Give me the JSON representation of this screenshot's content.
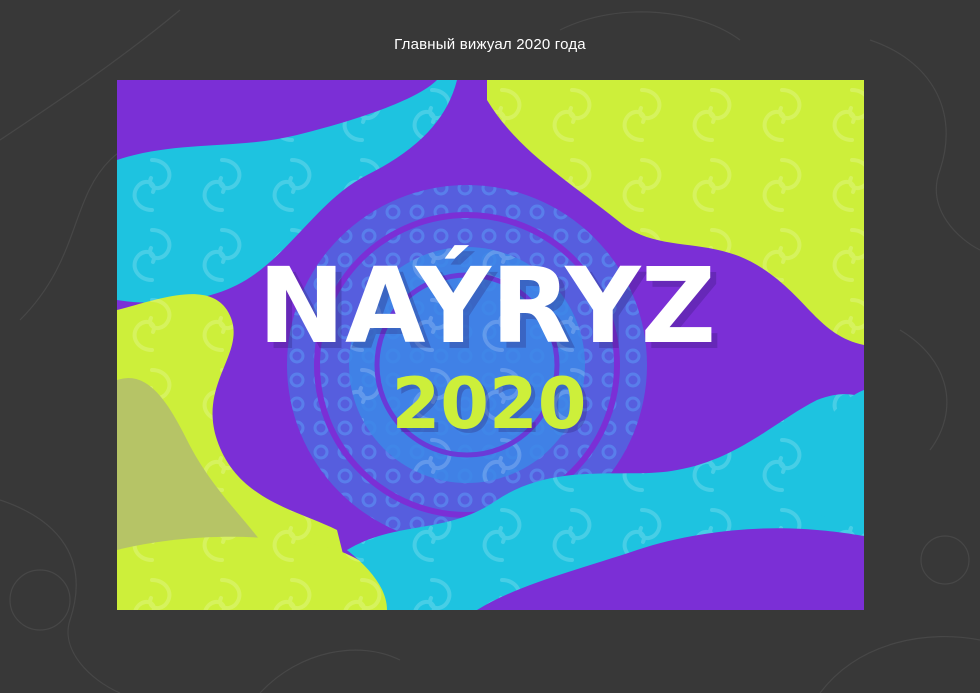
{
  "caption": "Главный вижуал 2020 года",
  "poster": {
    "title": "NAÝRYZ",
    "year": "2020",
    "colors": {
      "background": "#383838",
      "purple": "#7b2fd6",
      "purple_dark": "#5b1fb0",
      "cyan": "#1ec3e0",
      "lime": "#cdef3a",
      "olive": "#b6c466",
      "ornament_blue": "#3f86e6",
      "white": "#ffffff"
    }
  }
}
